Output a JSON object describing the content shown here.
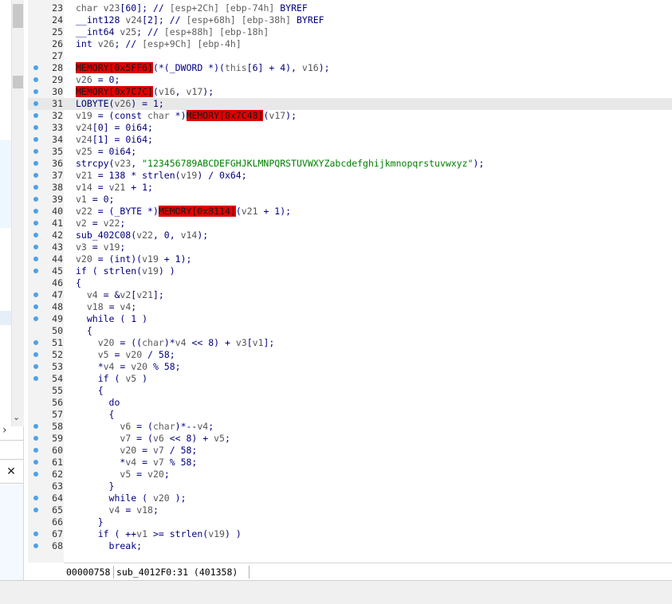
{
  "colors": {
    "blue_text": "#000080",
    "variable": "#555555",
    "string": "#008000",
    "highlight": "#e00000"
  },
  "left_panel": {
    "close_glyph": "✕",
    "chevron_down": "⌄",
    "chevron_right": "›"
  },
  "lines": [
    {
      "n": "23",
      "t": "char v23[60]; // [esp+2Ch] [ebp-74h] BYREF"
    },
    {
      "n": "24",
      "t": "__int128 v24[2]; // [esp+68h] [ebp-38h] BYREF"
    },
    {
      "n": "25",
      "t": "__int64 v25; // [esp+88h] [ebp-18h]"
    },
    {
      "n": "26",
      "t": "int v26; // [esp+9Ch] [ebp-4h]"
    },
    {
      "n": "27",
      "t": ""
    },
    {
      "n": "28",
      "t": "MEMORY[0x5FF6](*(_DWORD *)(this[6] + 4), v16);"
    },
    {
      "n": "29",
      "t": "v26 = 0;"
    },
    {
      "n": "30",
      "t": "MEMORY[0x7C7C](v16, v17);"
    },
    {
      "n": "31",
      "t": "LOBYTE(v26) = 1;"
    },
    {
      "n": "32",
      "t": "v19 = (const char *)MEMORY[0x7C48](v17);"
    },
    {
      "n": "33",
      "t": "v24[0] = 0i64;"
    },
    {
      "n": "34",
      "t": "v24[1] = 0i64;"
    },
    {
      "n": "35",
      "t": "v25 = 0i64;"
    },
    {
      "n": "36",
      "t": "strcpy(v23, \"123456789ABCDEFGHJKLMNPQRSTUVWXYZabcdefghijkmnopqrstuvwxyz\");"
    },
    {
      "n": "37",
      "t": "v21 = 138 * strlen(v19) / 0x64;"
    },
    {
      "n": "38",
      "t": "v14 = v21 + 1;"
    },
    {
      "n": "39",
      "t": "v1 = 0;"
    },
    {
      "n": "40",
      "t": "v22 = (_BYTE *)MEMORY[0x8114](v21 + 1);"
    },
    {
      "n": "41",
      "t": "v2 = v22;"
    },
    {
      "n": "42",
      "t": "sub_402C08(v22, 0, v14);"
    },
    {
      "n": "43",
      "t": "v3 = v19;"
    },
    {
      "n": "44",
      "t": "v20 = (int)(v19 + 1);"
    },
    {
      "n": "45",
      "t": "if ( strlen(v19) )"
    },
    {
      "n": "46",
      "t": "{"
    },
    {
      "n": "47",
      "t": "  v4 = &v2[v21];"
    },
    {
      "n": "48",
      "t": "  v18 = v4;"
    },
    {
      "n": "49",
      "t": "  while ( 1 )"
    },
    {
      "n": "50",
      "t": "  {"
    },
    {
      "n": "51",
      "t": "    v20 = ((char)*v4 << 8) + v3[v1];"
    },
    {
      "n": "52",
      "t": "    v5 = v20 / 58;"
    },
    {
      "n": "53",
      "t": "    *v4 = v20 % 58;"
    },
    {
      "n": "54",
      "t": "    if ( v5 )"
    },
    {
      "n": "55",
      "t": "    {"
    },
    {
      "n": "56",
      "t": "      do"
    },
    {
      "n": "57",
      "t": "      {"
    },
    {
      "n": "58",
      "t": "        v6 = (char)*--v4;"
    },
    {
      "n": "59",
      "t": "        v7 = (v6 << 8) + v5;"
    },
    {
      "n": "60",
      "t": "        v20 = v7 / 58;"
    },
    {
      "n": "61",
      "t": "        *v4 = v7 % 58;"
    },
    {
      "n": "62",
      "t": "        v5 = v20;"
    },
    {
      "n": "63",
      "t": "      }"
    },
    {
      "n": "64",
      "t": "      while ( v20 );"
    },
    {
      "n": "65",
      "t": "      v4 = v18;"
    },
    {
      "n": "66",
      "t": "    }"
    },
    {
      "n": "67",
      "t": "    if ( ++v1 >= strlen(v19) )"
    },
    {
      "n": "68",
      "t": "      break;"
    }
  ],
  "status": {
    "address": "00000758",
    "location": "sub_4012F0:31 (401358)"
  }
}
